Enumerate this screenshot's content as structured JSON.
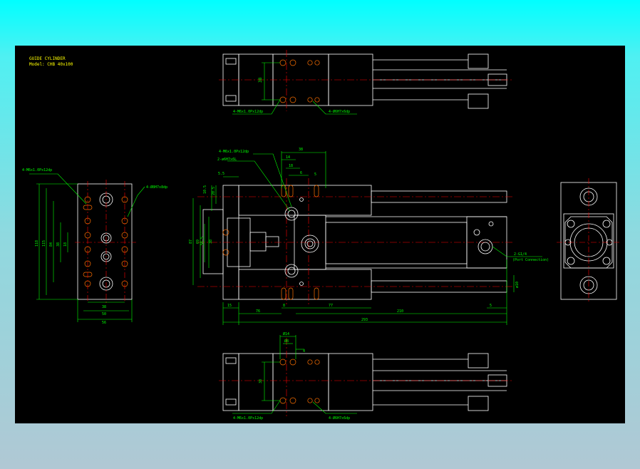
{
  "title_block": {
    "line1": "GUIDE CYLINDER",
    "line2": "Model: CHB 40x100"
  },
  "top_view": {
    "dim_38": "38",
    "note_left": "4-M6x1.0Px12dp",
    "note_right": "4-Ø6H7x6dp"
  },
  "side_view": {
    "dims": {
      "d38": "38",
      "d14": "14",
      "d18": "18",
      "d6": "6",
      "d5": "5",
      "d5_5": "5.5",
      "d10_5": "10.5",
      "d28_5": "28.5",
      "d87": "87",
      "d69": "69",
      "d38v": "38",
      "d56_5": "56.5",
      "d15": "15",
      "d76": "76",
      "d8": "8",
      "d77": "77",
      "d210": "210",
      "d5b": "5",
      "d293": "293",
      "phi10": "ø10"
    },
    "note_m6": "4-M6x1.0Px12dp",
    "note_pin": "2-ø6H7x6L",
    "note_port": "2-G1/4",
    "note_port_sub": "(Port Connection)"
  },
  "left_view": {
    "note_left": "4-M6x1.0Px12dp",
    "note_right": "4-Ø8H7x8dp",
    "dims": {
      "d118": "118",
      "d115": "115",
      "d84": "84",
      "d38": "38",
      "d18": "18",
      "w38": "38",
      "w50": "50",
      "w56": "56"
    }
  },
  "bottom_view": {
    "dim_14": "Ø14",
    "dim_8": "Ø8",
    "dim_4": "4",
    "dim_38": "38",
    "note_left": "4-M6x1.0Px12dp",
    "note_right": "4-Ø6H7x6dp"
  },
  "colors": {
    "outline": "#ffffff",
    "dimension": "#00ff00",
    "centerline": "#ff0000",
    "hidden": "#ff6000",
    "text_title": "#ffff00",
    "background": "#000000"
  }
}
